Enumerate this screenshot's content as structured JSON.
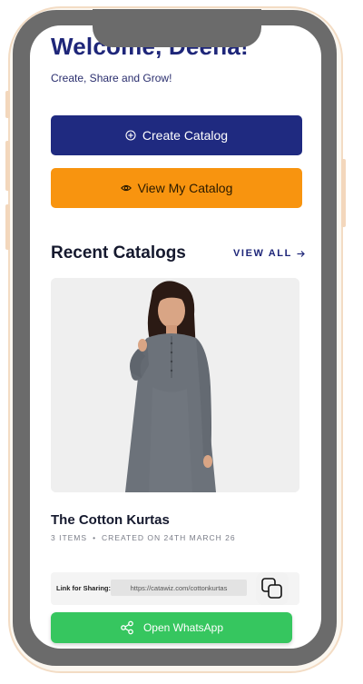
{
  "header": {
    "welcome_text": "Welcome, Deena!",
    "subtitle": "Create, Share and Grow!"
  },
  "actions": {
    "create_catalog": {
      "label": "Create Catalog",
      "icon": "plus-circle-icon"
    },
    "view_catalog": {
      "label": "View My Catalog",
      "icon": "eye-icon"
    }
  },
  "recent": {
    "title": "Recent Catalogs",
    "view_all": "VIEW ALL",
    "view_all_icon": "arrow-right-icon"
  },
  "catalog": {
    "title": "The Cotton Kurtas",
    "items": "3 ITEMS",
    "separator": "•",
    "created": "CREATED ON 24TH MARCH 26",
    "image": "product-photo-kurta"
  },
  "share": {
    "label": "Link for Sharing:",
    "link": "https://catawiz.com/cottonkurtas",
    "copy_icon": "copy-icon"
  },
  "whatsapp": {
    "label": "Open WhatsApp",
    "icon": "share-icon"
  },
  "colors": {
    "primary": "#1f2a80",
    "accent": "#f8940f",
    "whatsapp": "#36c65f",
    "bezel": "#6b6b6b"
  }
}
